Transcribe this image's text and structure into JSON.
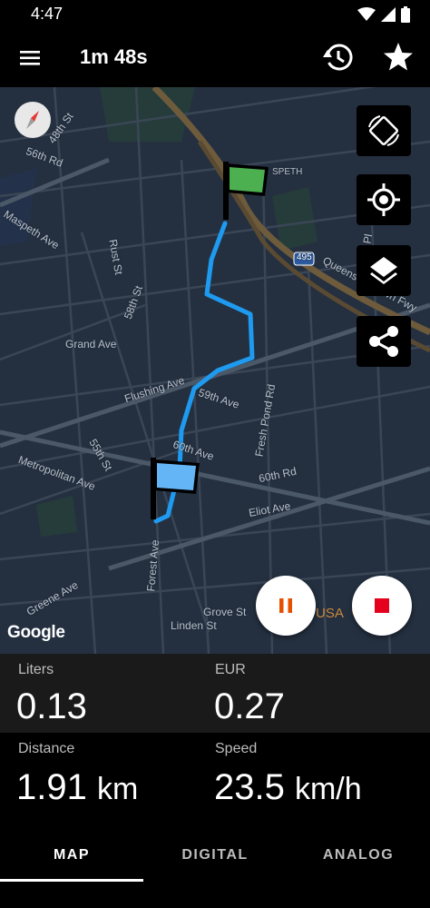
{
  "status_bar": {
    "time": "4:47"
  },
  "app_bar": {
    "title": "1m 48s",
    "menu_icon": "menu-icon",
    "history_icon": "history-icon",
    "favorite_icon": "star-icon"
  },
  "map": {
    "attribution": "Google",
    "labels": {
      "l_48th": "48th St",
      "l_56th_rd": "56th Rd",
      "l_maspeth": "Maspeth Ave",
      "l_rust": "Rust St",
      "l_58th": "58th St",
      "l_speth": "SPETH",
      "l_495": "495",
      "l_queens": "Queens Midtown Fwy",
      "l_grand": "Grand Ave",
      "l_flushing": "Flushing Ave",
      "l_59th_ave": "59th Ave",
      "l_fresh_pond": "Fresh Pond Rd",
      "l_55th": "55th St",
      "l_metropolitan": "Metropolitan Ave",
      "l_60th_ave": "60th Ave",
      "l_60th_rd": "60th Rd",
      "l_eliot": "Eliot Ave",
      "l_forest": "Forest Ave",
      "l_greene": "Greene Ave",
      "l_grove": "Grove St",
      "l_linden": "Linden St",
      "l_pl": "Pl",
      "l_usa": "USA"
    },
    "controls": [
      "screen-rotation-icon",
      "my-location-icon",
      "layers-icon",
      "share-icon"
    ],
    "pause_icon": "pause-icon",
    "stop_icon": "stop-icon",
    "colors": {
      "route": "#1e9bf0",
      "start_flag": "#4caf50",
      "end_flag": "#64b5f6",
      "pause": "#e65100",
      "stop": "#e5001e"
    }
  },
  "stats": {
    "liters": {
      "label": "Liters",
      "value": "0.13"
    },
    "currency": {
      "label": "EUR",
      "value": "0.27"
    },
    "distance": {
      "label": "Distance",
      "value": "1.91",
      "unit": "km"
    },
    "speed": {
      "label": "Speed",
      "value": "23.5",
      "unit": "km/h"
    }
  },
  "tabs": [
    {
      "label": "MAP",
      "selected": true
    },
    {
      "label": "DIGITAL",
      "selected": false
    },
    {
      "label": "ANALOG",
      "selected": false
    }
  ]
}
